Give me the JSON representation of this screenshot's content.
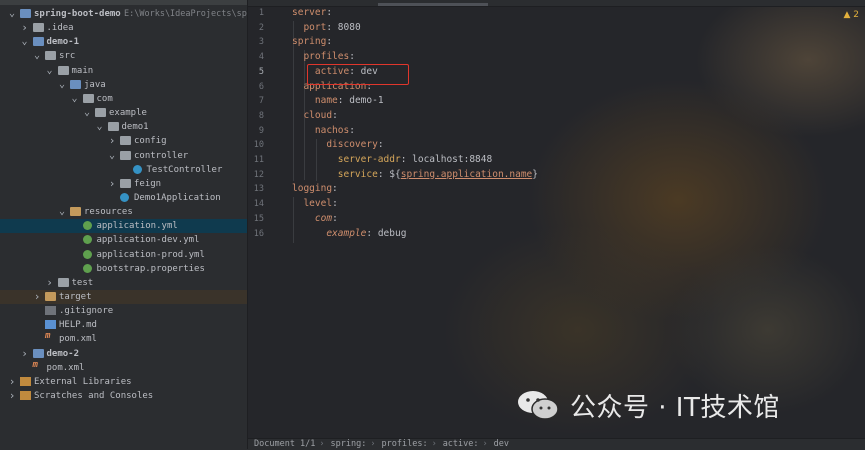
{
  "project": {
    "items": [
      {
        "label": "spring-boot-demo",
        "path": "E:\\Works\\IdeaProjects\\spri",
        "icon": "folder-module-icon",
        "bold": true
      },
      {
        "label": ".idea",
        "icon": "folder-icon"
      },
      {
        "label": "demo-1",
        "icon": "folder-module-icon",
        "bold": true
      },
      {
        "label": "src",
        "icon": "folder-icon"
      },
      {
        "label": "main",
        "icon": "folder-icon"
      },
      {
        "label": "java",
        "icon": "folder-source-icon"
      },
      {
        "label": "com",
        "icon": "package-icon"
      },
      {
        "label": "example",
        "icon": "package-icon"
      },
      {
        "label": "demo1",
        "icon": "package-icon"
      },
      {
        "label": "config",
        "icon": "package-icon"
      },
      {
        "label": "controller",
        "icon": "package-icon"
      },
      {
        "label": "TestController",
        "icon": "class-icon"
      },
      {
        "label": "feign",
        "icon": "package-icon"
      },
      {
        "label": "Demo1Application",
        "icon": "spring-app-icon"
      },
      {
        "label": "resources",
        "icon": "folder-resources-icon"
      },
      {
        "label": "application.yml",
        "icon": "yml-file-icon"
      },
      {
        "label": "application-dev.yml",
        "icon": "yml-file-icon"
      },
      {
        "label": "application-prod.yml",
        "icon": "yml-file-icon"
      },
      {
        "label": "bootstrap.properties",
        "icon": "properties-file-icon"
      },
      {
        "label": "test",
        "icon": "folder-icon"
      },
      {
        "label": "target",
        "icon": "folder-excluded-icon"
      },
      {
        "label": ".gitignore",
        "icon": "gitignore-file-icon"
      },
      {
        "label": "HELP.md",
        "icon": "markdown-file-icon"
      },
      {
        "label": "pom.xml",
        "icon": "maven-file-icon"
      },
      {
        "label": "demo-2",
        "icon": "folder-module-icon",
        "bold": true
      },
      {
        "label": "pom.xml",
        "icon": "maven-file-icon"
      },
      {
        "label": "External Libraries",
        "icon": "library-icon"
      },
      {
        "label": "Scratches and Consoles",
        "icon": "scratches-icon"
      }
    ]
  },
  "editor": {
    "line_numbers": [
      "1",
      "2",
      "3",
      "4",
      "5",
      "6",
      "7",
      "8",
      "9",
      "10",
      "11",
      "12",
      "13",
      "14",
      "15",
      "16"
    ],
    "current_line": "5",
    "warnings": "▲ 2",
    "code": {
      "l1_key": "server",
      "l2_key": "port",
      "l2_val": "8080",
      "l3_key": "spring",
      "l4_key": "profiles",
      "l5_key": "active",
      "l5_val": "dev",
      "l6_key": "application",
      "l7_key": "name",
      "l7_val": "demo-1",
      "l8_key": "cloud",
      "l9_key": "nachos",
      "l10_key": "discovery",
      "l11_key": "server-addr",
      "l11_val": "localhost:8848",
      "l12_key": "service",
      "l12_val_pre": "${",
      "l12_val_ref": "spring.application.name",
      "l12_val_post": "}",
      "l13_key": "logging",
      "l14_key": "level",
      "l15_key": "com",
      "l16_key": "example",
      "l16_val": "debug"
    }
  },
  "breadcrumb": {
    "doc": "Document 1/1",
    "items": [
      "spring:",
      "profiles:",
      "active:",
      "dev"
    ]
  },
  "watermark": {
    "text": "公众号 · IT技术馆"
  },
  "colors": {
    "highlight_box": "#e0362c",
    "yaml_key": "#cf8e6d",
    "selection": "#0f3a4e"
  }
}
